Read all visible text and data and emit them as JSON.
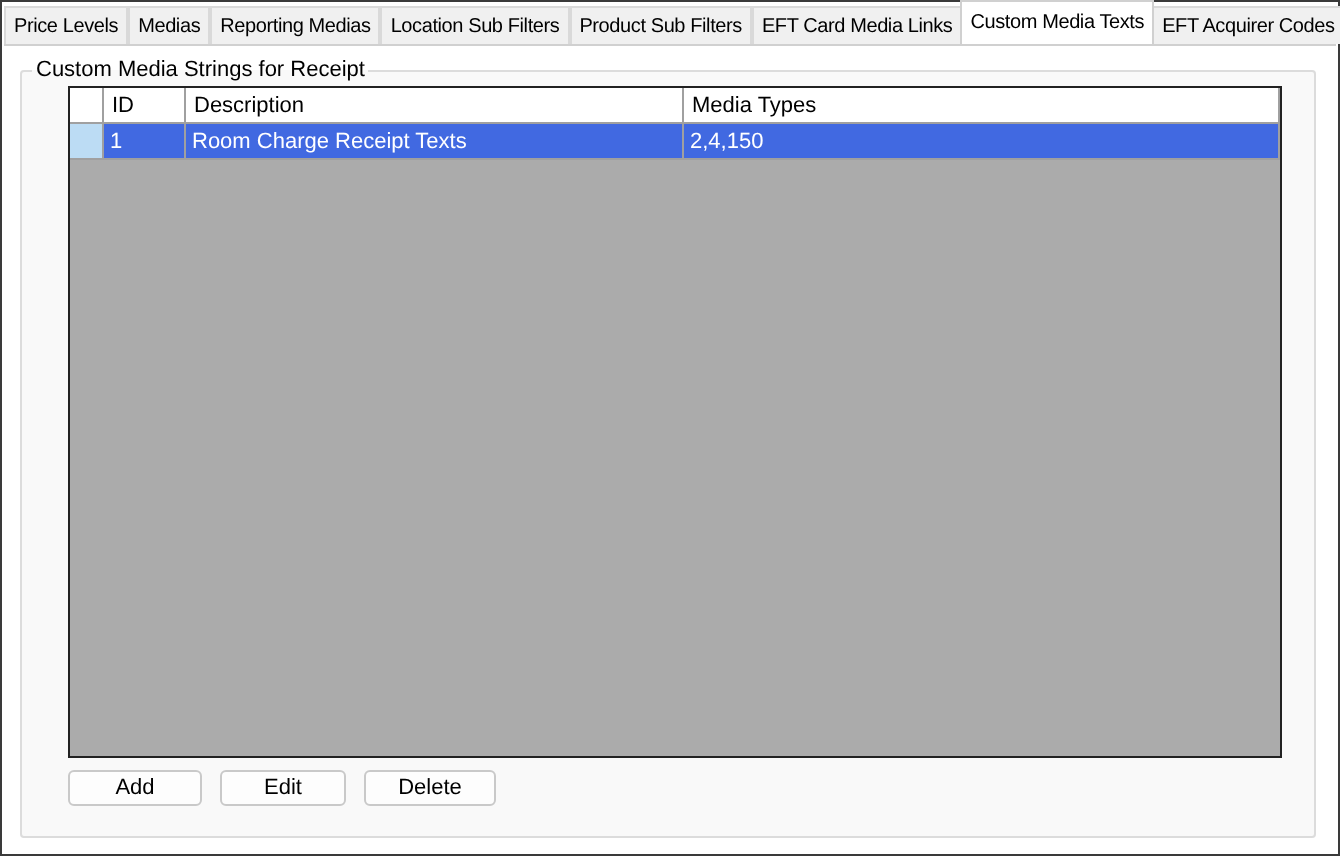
{
  "tabs": [
    {
      "label": "Price Levels",
      "selected": false
    },
    {
      "label": "Medias",
      "selected": false
    },
    {
      "label": "Reporting Medias",
      "selected": false
    },
    {
      "label": "Location Sub Filters",
      "selected": false
    },
    {
      "label": "Product Sub Filters",
      "selected": false
    },
    {
      "label": "EFT Card Media Links",
      "selected": false
    },
    {
      "label": "Custom Media Texts",
      "selected": true
    },
    {
      "label": "EFT Acquirer Codes",
      "selected": false
    }
  ],
  "group": {
    "title": "Custom Media Strings for Receipt"
  },
  "table": {
    "columns": [
      "ID",
      "Description",
      "Media Types"
    ],
    "rows": [
      {
        "cells": [
          "1",
          "Room Charge Receipt Texts",
          "2,4,150"
        ],
        "selected": true
      }
    ]
  },
  "buttons": [
    "Add",
    "Edit",
    "Delete"
  ]
}
